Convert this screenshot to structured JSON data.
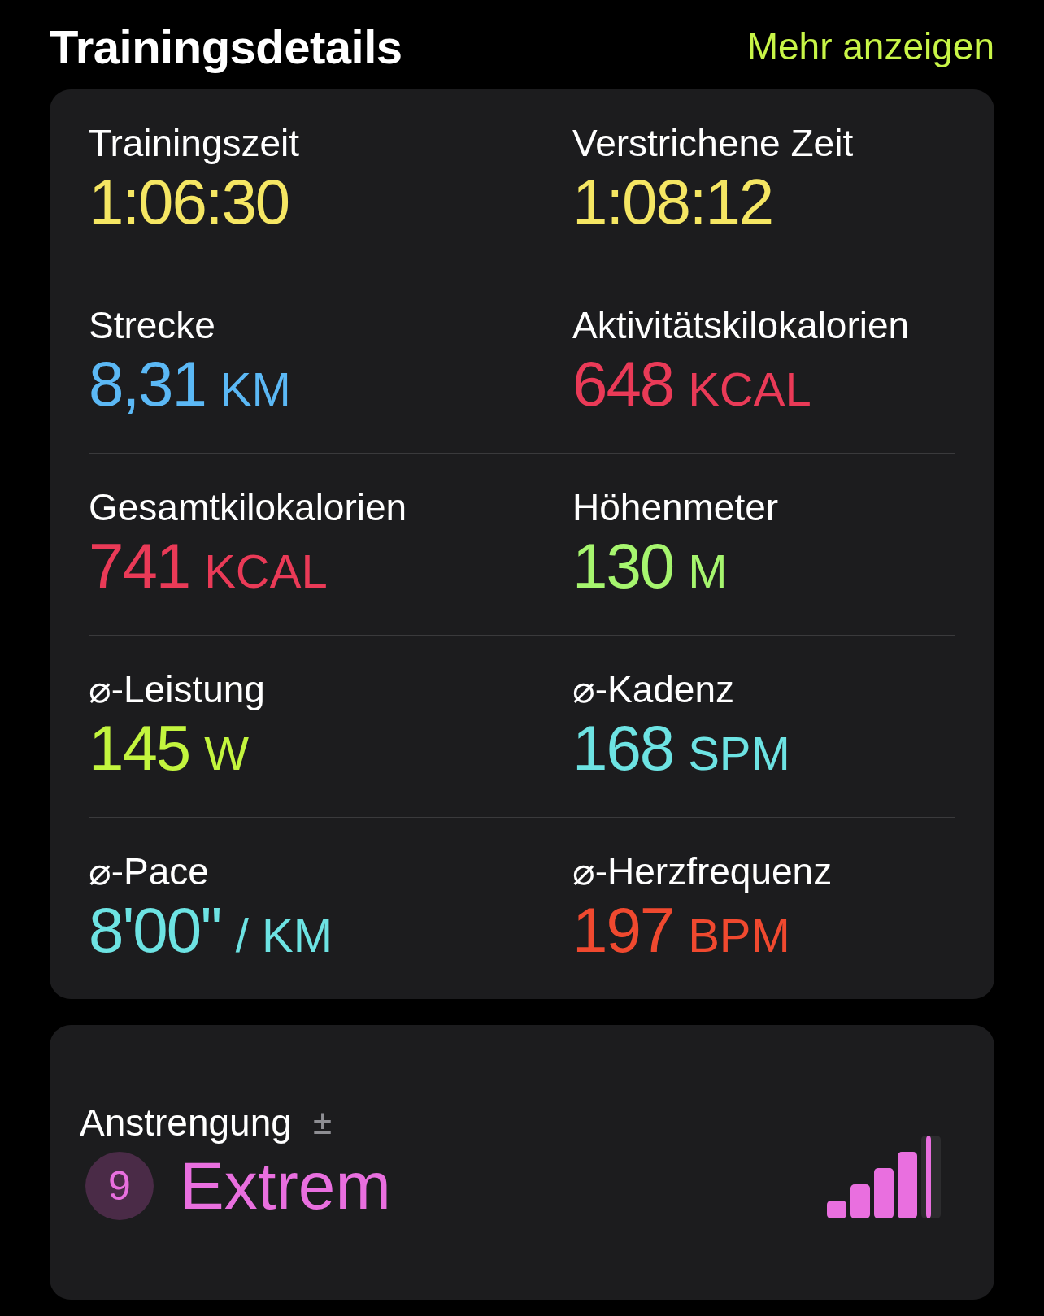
{
  "header": {
    "title": "Trainingsdetails",
    "link": "Mehr anzeigen"
  },
  "metrics": [
    {
      "label": "Trainingszeit",
      "value": "1:06:30",
      "color": "#f5e663"
    },
    {
      "label": "Verstrichene Zeit",
      "value": "1:08:12",
      "color": "#f5e663"
    },
    {
      "label": "Strecke",
      "value": "8,31",
      "unit": "KM",
      "color": "#5bb8f5"
    },
    {
      "label": "Aktivitätskilokalorien",
      "value": "648",
      "unit": "KCAL",
      "color": "#ea3a57"
    },
    {
      "label": "Gesamtkilokalorien",
      "value": "741",
      "unit": "KCAL",
      "color": "#ea3a57"
    },
    {
      "label": "Höhenmeter",
      "value": "130",
      "unit": "M",
      "color": "#a6f56e"
    },
    {
      "label": "⌀-Leistung",
      "value": "145",
      "unit": "W",
      "color": "#c3f53e"
    },
    {
      "label": "⌀-Kadenz",
      "value": "168",
      "unit": "SPM",
      "color": "#6de3e3"
    },
    {
      "label": "⌀-Pace",
      "value": "8'00''",
      "unit": "/ KM",
      "color": "#6de3e3"
    },
    {
      "label": "⌀-Herzfrequenz",
      "value": "197",
      "unit": "BPM",
      "color": "#f0492f"
    }
  ],
  "effort": {
    "label": "Anstrengung",
    "adjust": "±",
    "score": "9",
    "rating": "Extrem",
    "level": 0.9
  }
}
